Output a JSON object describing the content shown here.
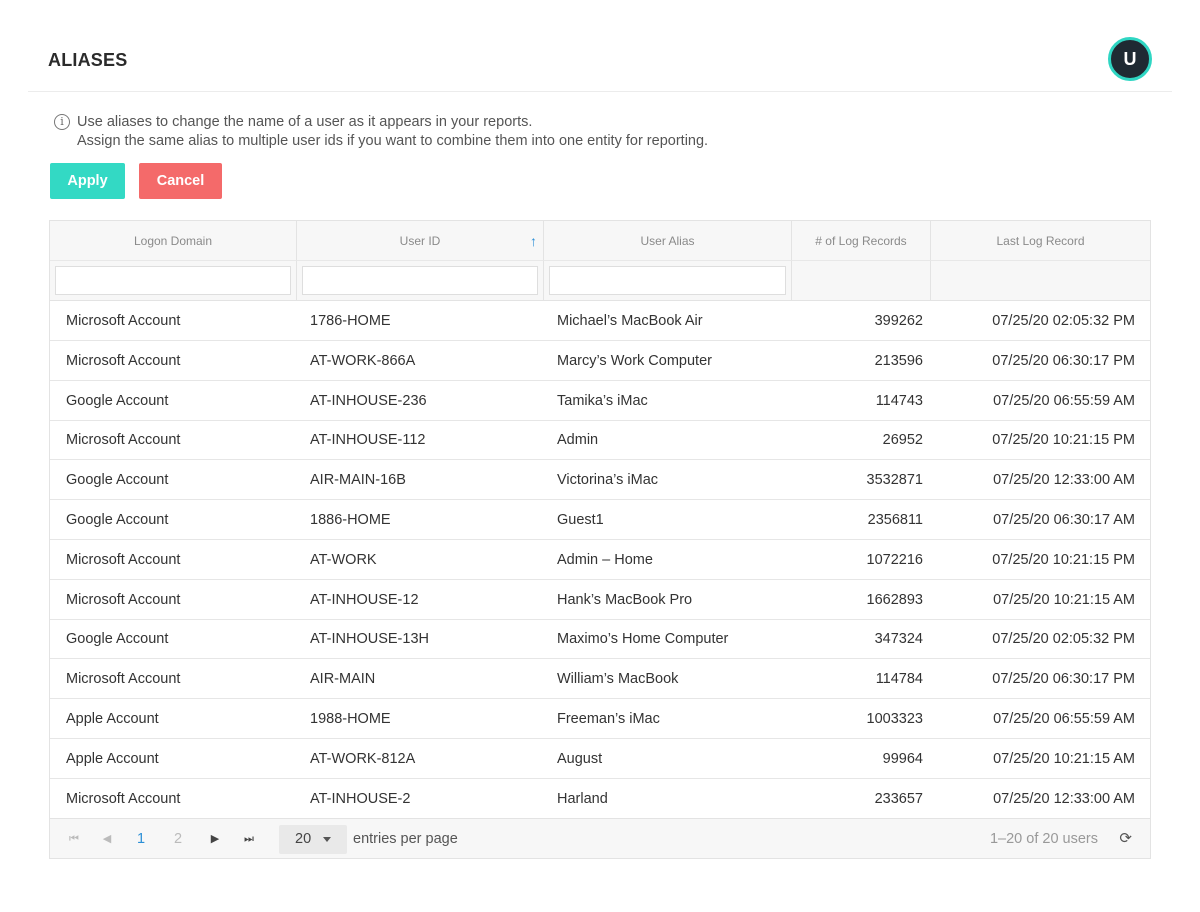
{
  "header": {
    "title": "ALIASES",
    "avatar_initial": "U"
  },
  "info": {
    "icon": "info-icon",
    "line1": "Use aliases to change the name of a user as it appears in your reports.",
    "line2": "Assign the same alias to multiple user ids if you want to combine them into one entity for reporting."
  },
  "actions": {
    "apply_label": "Apply",
    "cancel_label": "Cancel",
    "apply_color": "#33d9c4",
    "cancel_color": "#f46a6a"
  },
  "table": {
    "columns": [
      "Logon Domain",
      "User ID",
      "User Alias",
      "# of Log Records",
      "Last Log Record"
    ],
    "sort": {
      "column": "User ID",
      "direction": "ascending",
      "icon": "arrow-up-icon"
    },
    "filters": {
      "domain": "",
      "user_id": "",
      "alias": ""
    },
    "rows": [
      [
        "Microsoft Account",
        "1786-HOME",
        "Michael’s MacBook Air",
        "399262",
        "07/25/20 02:05:32 PM"
      ],
      [
        "Microsoft Account",
        "AT-WORK-866A",
        "Marcy’s Work Computer",
        "213596",
        "07/25/20 06:30:17 PM"
      ],
      [
        "Google Account",
        "AT-INHOUSE-236",
        "Tamika’s iMac",
        "114743",
        "07/25/20 06:55:59 AM"
      ],
      [
        "Microsoft Account",
        "AT-INHOUSE-112",
        "Admin",
        "26952",
        "07/25/20 10:21:15 PM"
      ],
      [
        "Google Account",
        "AIR-MAIN-16B",
        "Victorina’s iMac",
        "3532871",
        "07/25/20 12:33:00 AM"
      ],
      [
        "Google Account",
        "1886-HOME",
        "Guest1",
        "2356811",
        "07/25/20 06:30:17 AM"
      ],
      [
        "Microsoft Account",
        "AT-WORK",
        "Admin – Home",
        "1072216",
        "07/25/20 10:21:15 PM"
      ],
      [
        "Microsoft Account",
        "AT-INHOUSE-12",
        "Hank’s MacBook Pro",
        "1662893",
        "07/25/20 10:21:15 AM"
      ],
      [
        "Google Account",
        "AT-INHOUSE-13H",
        "Maximo’s Home Computer",
        "347324",
        "07/25/20 02:05:32 PM"
      ],
      [
        "Microsoft Account",
        "AIR-MAIN",
        "William’s MacBook",
        "114784",
        "07/25/20 06:30:17 PM"
      ],
      [
        "Apple Account",
        "1988-HOME",
        "Freeman’s iMac",
        "1003323",
        "07/25/20 06:55:59 AM"
      ],
      [
        "Apple Account",
        "AT-WORK-812A",
        "August",
        "99964",
        "07/25/20 10:21:15 AM"
      ],
      [
        "Microsoft Account",
        "AT-INHOUSE-2",
        "Harland",
        "233657",
        "07/25/20 12:33:00 AM"
      ]
    ]
  },
  "pagination": {
    "pages": [
      "1",
      "2"
    ],
    "current_page": "1",
    "per_page": "20",
    "per_page_label": "entries per page",
    "range_text": "1–20 of 20 users"
  }
}
